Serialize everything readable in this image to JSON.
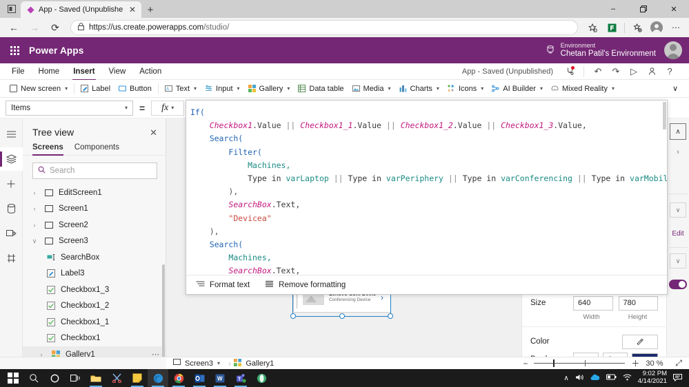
{
  "browser": {
    "tab": {
      "title": "App - Saved (Unpublished) - Po...",
      "favicon_name": "powerapps-diamond-icon",
      "close_label": "✕"
    },
    "new_tab_label": "+",
    "window_controls": {
      "minimize": "–",
      "maximize": "❐",
      "close": "✕"
    },
    "nav": {
      "back": "←",
      "forward": "→",
      "reload": "⟳"
    },
    "url": {
      "lock_icon": "🔒",
      "prefix": "https://us.create.powerapps.com",
      "suffix": "/studio/"
    },
    "toolbar_icons": {
      "favorite": "☆",
      "collections": "❐",
      "profile": "profile-avatar",
      "more": "⋯"
    }
  },
  "pa_header": {
    "brand": "Power Apps",
    "env_label": "Environment",
    "env_name": "Chetan Patil's Environment"
  },
  "menubar": {
    "items": [
      {
        "label": "File",
        "active": false
      },
      {
        "label": "Home",
        "active": false
      },
      {
        "label": "Insert",
        "active": true
      },
      {
        "label": "View",
        "active": false
      },
      {
        "label": "Action",
        "active": false
      }
    ],
    "saved_status": "App - Saved (Unpublished)",
    "icons": [
      {
        "name": "checker-icon",
        "glyph": "⚕"
      },
      {
        "name": "undo-icon",
        "glyph": "↶"
      },
      {
        "name": "redo-icon",
        "glyph": "↷"
      },
      {
        "name": "play-preview-icon",
        "glyph": "▷"
      },
      {
        "name": "share-icon",
        "glyph": "⚹"
      },
      {
        "name": "help-icon",
        "glyph": "?"
      }
    ]
  },
  "ribbon": {
    "items": [
      {
        "label": "New screen",
        "icon": "⬜",
        "caret": true
      },
      {
        "label": "Label",
        "icon": "✎",
        "caret": false
      },
      {
        "label": "Button",
        "icon": "⬚",
        "caret": false
      },
      {
        "label": "Text",
        "icon": "▤",
        "caret": true
      },
      {
        "label": "Input",
        "icon": "≡",
        "caret": true
      },
      {
        "label": "Gallery",
        "icon": "▦",
        "caret": true
      },
      {
        "label": "Data table",
        "icon": "▥",
        "caret": false
      },
      {
        "label": "Media",
        "icon": "⛰",
        "caret": true
      },
      {
        "label": "Charts",
        "icon": "◫",
        "caret": true
      },
      {
        "label": "Icons",
        "icon": "❖",
        "caret": true
      },
      {
        "label": "AI Builder",
        "icon": "❁",
        "caret": true
      },
      {
        "label": "Mixed Reality",
        "icon": "◐",
        "caret": true
      }
    ],
    "more_caret": "∨"
  },
  "property_row": {
    "selected_property": "Items",
    "equals": "=",
    "fx_label": "fx",
    "caret": "∨"
  },
  "left_rail": [
    {
      "name": "menu-hamburger-icon",
      "glyph": "☰",
      "active": false
    },
    {
      "name": "tree-view-icon",
      "glyph": "☰",
      "active": true
    },
    {
      "name": "insert-add-icon",
      "glyph": "＋",
      "active": false
    },
    {
      "name": "data-sources-icon",
      "glyph": "⛃",
      "active": false
    },
    {
      "name": "media-icon",
      "glyph": "❐",
      "active": false
    },
    {
      "name": "variables-icon",
      "glyph": "⚖",
      "active": false
    }
  ],
  "tree_view": {
    "title": "Tree view",
    "close_glyph": "✕",
    "tabs": [
      {
        "label": "Screens",
        "active": true
      },
      {
        "label": "Components",
        "active": false
      }
    ],
    "search_placeholder": "Search",
    "search_icon": "⚲",
    "nodes": [
      {
        "label": "EditScreen1",
        "indent": 0,
        "twisty": "›",
        "icon": "screen-icon",
        "selected": false,
        "dots": false
      },
      {
        "label": "Screen1",
        "indent": 0,
        "twisty": "›",
        "icon": "screen-icon",
        "selected": false,
        "dots": false
      },
      {
        "label": "Screen2",
        "indent": 0,
        "twisty": "›",
        "icon": "screen-icon",
        "selected": false,
        "dots": false
      },
      {
        "label": "Screen3",
        "indent": 0,
        "twisty": "∨",
        "icon": "screen-icon",
        "selected": false,
        "dots": false
      },
      {
        "label": "SearchBox",
        "indent": 1,
        "twisty": "",
        "icon": "textinput-icon",
        "selected": false,
        "dots": false
      },
      {
        "label": "Label3",
        "indent": 1,
        "twisty": "",
        "icon": "label-icon",
        "selected": false,
        "dots": false
      },
      {
        "label": "Checkbox1_3",
        "indent": 1,
        "twisty": "",
        "icon": "checkbox-icon",
        "selected": false,
        "dots": false
      },
      {
        "label": "Checkbox1_2",
        "indent": 1,
        "twisty": "",
        "icon": "checkbox-icon",
        "selected": false,
        "dots": false
      },
      {
        "label": "Checkbox1_1",
        "indent": 1,
        "twisty": "",
        "icon": "checkbox-icon",
        "selected": false,
        "dots": false
      },
      {
        "label": "Checkbox1",
        "indent": 1,
        "twisty": "",
        "icon": "checkbox-icon",
        "selected": false,
        "dots": false
      },
      {
        "label": "Gallery1",
        "indent": 1,
        "twisty": "›",
        "icon": "gallery-icon",
        "selected": true,
        "dots": true
      }
    ]
  },
  "formula": {
    "lines": [
      [
        {
          "t": "If(",
          "c": "fn"
        }
      ],
      [
        {
          "t": "    ",
          "c": "kw"
        },
        {
          "t": "Checkbox1",
          "c": "ctl"
        },
        {
          "t": ".Value",
          "c": "prop"
        },
        {
          "t": " || ",
          "c": "op"
        },
        {
          "t": "Checkbox1_1",
          "c": "ctl"
        },
        {
          "t": ".Value",
          "c": "prop"
        },
        {
          "t": " || ",
          "c": "op"
        },
        {
          "t": "Checkbox1_2",
          "c": "ctl"
        },
        {
          "t": ".Value",
          "c": "prop"
        },
        {
          "t": " || ",
          "c": "op"
        },
        {
          "t": "Checkbox1_3",
          "c": "ctl"
        },
        {
          "t": ".Value,",
          "c": "prop"
        }
      ],
      [
        {
          "t": "    ",
          "c": "kw"
        },
        {
          "t": "Search(",
          "c": "fn"
        }
      ],
      [
        {
          "t": "        ",
          "c": "kw"
        },
        {
          "t": "Filter(",
          "c": "fn"
        }
      ],
      [
        {
          "t": "            ",
          "c": "kw"
        },
        {
          "t": "Machines,",
          "c": "tbl"
        }
      ],
      [
        {
          "t": "            ",
          "c": "kw"
        },
        {
          "t": "Type in ",
          "c": "kw"
        },
        {
          "t": "varLaptop",
          "c": "var"
        },
        {
          "t": " || ",
          "c": "op"
        },
        {
          "t": "Type in ",
          "c": "kw"
        },
        {
          "t": "varPeriphery",
          "c": "var"
        },
        {
          "t": " || ",
          "c": "op"
        },
        {
          "t": "Type in ",
          "c": "kw"
        },
        {
          "t": "varConferencing",
          "c": "var"
        },
        {
          "t": " || ",
          "c": "op"
        },
        {
          "t": "Type in ",
          "c": "kw"
        },
        {
          "t": "varMobile",
          "c": "var"
        }
      ],
      [
        {
          "t": "        ",
          "c": "kw"
        },
        {
          "t": "),",
          "c": "pn"
        }
      ],
      [
        {
          "t": "        ",
          "c": "kw"
        },
        {
          "t": "SearchBox",
          "c": "ctl"
        },
        {
          "t": ".Text,",
          "c": "prop"
        }
      ],
      [
        {
          "t": "        ",
          "c": "kw"
        },
        {
          "t": "\"Devicea\"",
          "c": "str"
        }
      ],
      [
        {
          "t": "    ",
          "c": "kw"
        },
        {
          "t": "),",
          "c": "pn"
        }
      ],
      [
        {
          "t": "    ",
          "c": "kw"
        },
        {
          "t": "Search(",
          "c": "fn"
        }
      ],
      [
        {
          "t": "        ",
          "c": "kw"
        },
        {
          "t": "Machines,",
          "c": "tbl"
        }
      ],
      [
        {
          "t": "        ",
          "c": "kw"
        },
        {
          "t": "SearchBox",
          "c": "ctl"
        },
        {
          "t": ".Text,",
          "c": "prop"
        }
      ],
      [
        {
          "t": "        ",
          "c": "kw"
        },
        {
          "t": "\"Devicea\"",
          "c": "str"
        }
      ],
      [
        {
          "t": "    ",
          "c": "kw"
        },
        {
          "t": ")",
          "c": "pn"
        }
      ],
      [
        {
          "t": ")",
          "c": "pn"
        }
      ]
    ],
    "footer": {
      "format_text": "Format text",
      "format_text_icon": "≣",
      "remove_formatting": "Remove formatting",
      "remove_formatting_icon": "≡"
    }
  },
  "canvas": {
    "gallery_item": {
      "title": "Lenovo Conf Device",
      "subtitle": "Conferencing Device",
      "chevron": "›"
    }
  },
  "right_panel": {
    "size": {
      "label": "Size",
      "width_value": "640",
      "height_value": "780",
      "width_label": "Width",
      "height_label": "Height"
    },
    "color": {
      "label": "Color",
      "picker_icon": "◑"
    },
    "border": {
      "label": "Border",
      "style_glyph": "—",
      "caret": "∨",
      "thickness": "0",
      "color_hex": "#1b2a6b"
    }
  },
  "right_rail": {
    "collapse_glyph": "∧",
    "expand_glyph": "›",
    "chevron_down": "∨",
    "edit_label": "Edit",
    "toggle_on": true
  },
  "statusbar": {
    "screen_name": "Screen3",
    "screen_caret": "∨",
    "breadcrumb_arrow": "›",
    "control_name": "Gallery1",
    "zoom_minus": "−",
    "zoom_plus": "＋",
    "zoom_value": "30",
    "zoom_unit": "%",
    "fit_icon": "⤢"
  },
  "taskbar": {
    "buttons": [
      {
        "name": "start-button",
        "glyph": "windows-logo",
        "open": false,
        "focus": false
      },
      {
        "name": "search-icon",
        "glyph": "⚲",
        "open": false,
        "focus": false
      },
      {
        "name": "cortana-icon",
        "glyph": "◯",
        "open": false,
        "focus": false
      },
      {
        "name": "task-view-icon",
        "glyph": "⧉",
        "open": false,
        "focus": false
      },
      {
        "name": "file-explorer-icon",
        "glyph": "🗀",
        "open": true,
        "focus": false
      },
      {
        "name": "snipping-tool-icon",
        "glyph": "✂",
        "open": false,
        "focus": false
      },
      {
        "name": "sticky-notes-icon",
        "glyph": "■",
        "open": true,
        "focus": false
      },
      {
        "name": "edge-browser-icon",
        "glyph": "◔",
        "open": true,
        "focus": true
      },
      {
        "name": "chrome-icon",
        "glyph": "●",
        "open": true,
        "focus": false
      },
      {
        "name": "outlook-icon",
        "glyph": "O",
        "open": true,
        "focus": false
      },
      {
        "name": "word-icon",
        "glyph": "W",
        "open": true,
        "focus": false
      },
      {
        "name": "teams-icon",
        "glyph": "T",
        "open": true,
        "focus": false
      },
      {
        "name": "opera-icon",
        "glyph": "◕",
        "open": false,
        "focus": false
      }
    ],
    "tray": {
      "chevron": "∧",
      "volume": "🔊",
      "onedrive": "☁",
      "battery": "▭",
      "network": "◠",
      "time": "9:02 PM",
      "date": "4/14/2021",
      "action_center": "▤"
    }
  }
}
